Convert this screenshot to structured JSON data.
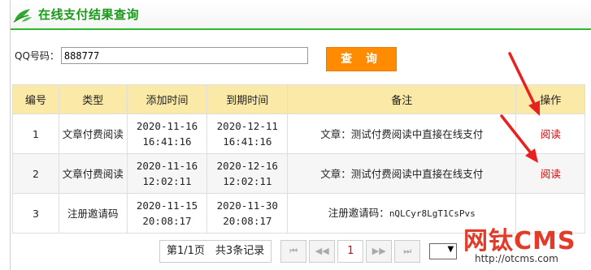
{
  "header": {
    "title": "在线支付结果查询"
  },
  "search": {
    "label": "QQ号码：",
    "value": "888777",
    "button_label": "查 询"
  },
  "table": {
    "columns": [
      "编号",
      "类型",
      "添加时间",
      "到期时间",
      "备注",
      "操作"
    ],
    "rows": [
      {
        "id": "1",
        "type": "文章付费阅读",
        "added": [
          "2020-11-16",
          "16:41:16"
        ],
        "expires": [
          "2020-12-11",
          "16:41:16"
        ],
        "remark": "文章：测试付费阅读中直接在线支付",
        "action": "阅读"
      },
      {
        "id": "2",
        "type": "文章付费阅读",
        "added": [
          "2020-11-16",
          "12:02:11"
        ],
        "expires": [
          "2020-12-16",
          "12:02:11"
        ],
        "remark": "文章：测试付费阅读中直接在线支付",
        "action": "阅读"
      },
      {
        "id": "3",
        "type": "注册邀请码",
        "added": [
          "2020-11-15",
          "20:08:17"
        ],
        "expires": [
          "2020-11-30",
          "20:08:17"
        ],
        "remark_prefix": "注册邀请码：",
        "remark_code": "nQLCyr8LgT1CsPvs",
        "action": ""
      }
    ]
  },
  "pager": {
    "info": "第1/1页　共3条记录",
    "first": "⏮",
    "prev": "◀◀",
    "current": "1",
    "next": "▶▶",
    "last": "⏭",
    "select_arrow": "▼"
  },
  "watermark": {
    "brand": "网钛CMS",
    "url": "http://otcms.com"
  },
  "colors": {
    "accent_green": "#2dbb2d",
    "button_orange": "#ff8c00",
    "header_row": "#fbe9a7",
    "action_red": "#e60000",
    "arrow_red": "#e8211e"
  }
}
